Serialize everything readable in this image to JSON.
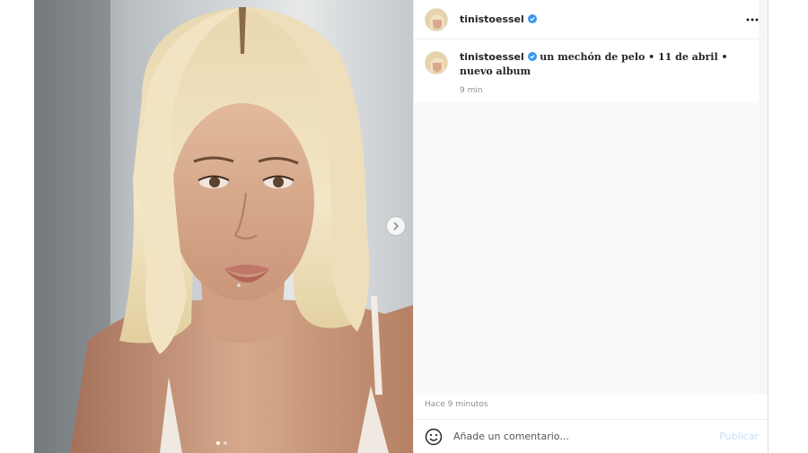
{
  "post": {
    "username": "tinistoessel",
    "more_icon": "more-horizontal-icon",
    "caption": {
      "username": "tinistoessel",
      "text": "un mechón de pelo • 11 de abril • nuevo album",
      "relative_time": "9 min"
    },
    "timestamp": "Hace 9 minutos",
    "comment": {
      "placeholder": "Añade un comentario...",
      "value": "",
      "publish_label": "Publicar"
    },
    "carousel": {
      "current": 1,
      "total": 2
    },
    "colors": {
      "verified": "#3897f0",
      "publish_disabled": "#c7e0f4",
      "text": "#262626",
      "muted": "#8e8e8e"
    }
  }
}
